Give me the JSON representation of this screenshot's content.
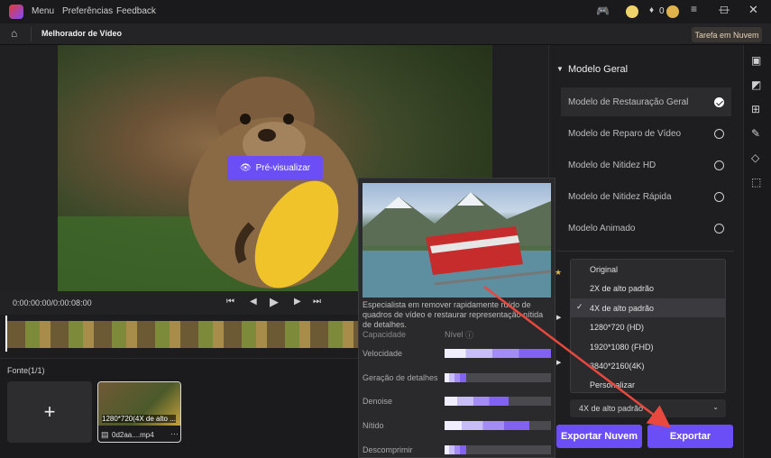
{
  "titlebar": {
    "menu_items": [
      "Menu",
      "Preferências",
      "Feedback"
    ],
    "credits": "0"
  },
  "subbar": {
    "title": "Melhorador de Vídeo",
    "task_button": "Tarefa em Nuvem"
  },
  "preview": {
    "button": "Pré-visualizar",
    "time": "0:00:00:00/0:00:08:00"
  },
  "source": {
    "label": "Fonte(1/1)",
    "thumb_caption": "1280*720(4X de alto ...",
    "thumb_file": "0d2aa....mp4"
  },
  "tooltip": {
    "description": "Especialista em remover rapidamente ruído de quadros de vídeo e restaurar representação nítida de detalhes.",
    "col_capacity": "Capacidade",
    "col_level": "Nível",
    "metrics": [
      {
        "label": "Velocidade",
        "level": 1.0
      },
      {
        "label": "Geração de detalhes",
        "level": 0.2
      },
      {
        "label": "Denoise",
        "level": 0.6
      },
      {
        "label": "Nítido",
        "level": 0.8
      },
      {
        "label": "Descomprimir",
        "level": 0.2
      }
    ]
  },
  "panel": {
    "section_title": "Modelo Geral",
    "models": [
      {
        "label": "Modelo de Restauração Geral",
        "selected": true
      },
      {
        "label": "Modelo de Reparo de Vídeo",
        "selected": false
      },
      {
        "label": "Modelo de Nitidez HD",
        "selected": false
      },
      {
        "label": "Modelo de Nitidez Rápida",
        "selected": false
      },
      {
        "label": "Modelo Animado",
        "selected": false
      }
    ],
    "resolution_options": [
      "Original",
      "2X de alto padrão",
      "4X de alto padrão",
      "1280*720 (HD)",
      "1920*1080 (FHD)",
      "3840*2160(4K)",
      "Personalizar"
    ],
    "selected_resolution": "4X de alto padrão",
    "cloud_export": "Exportar Nuvem",
    "export": "Exportar"
  },
  "colors": {
    "accent": "#6b4ef5",
    "arrow": "#e8483d"
  }
}
